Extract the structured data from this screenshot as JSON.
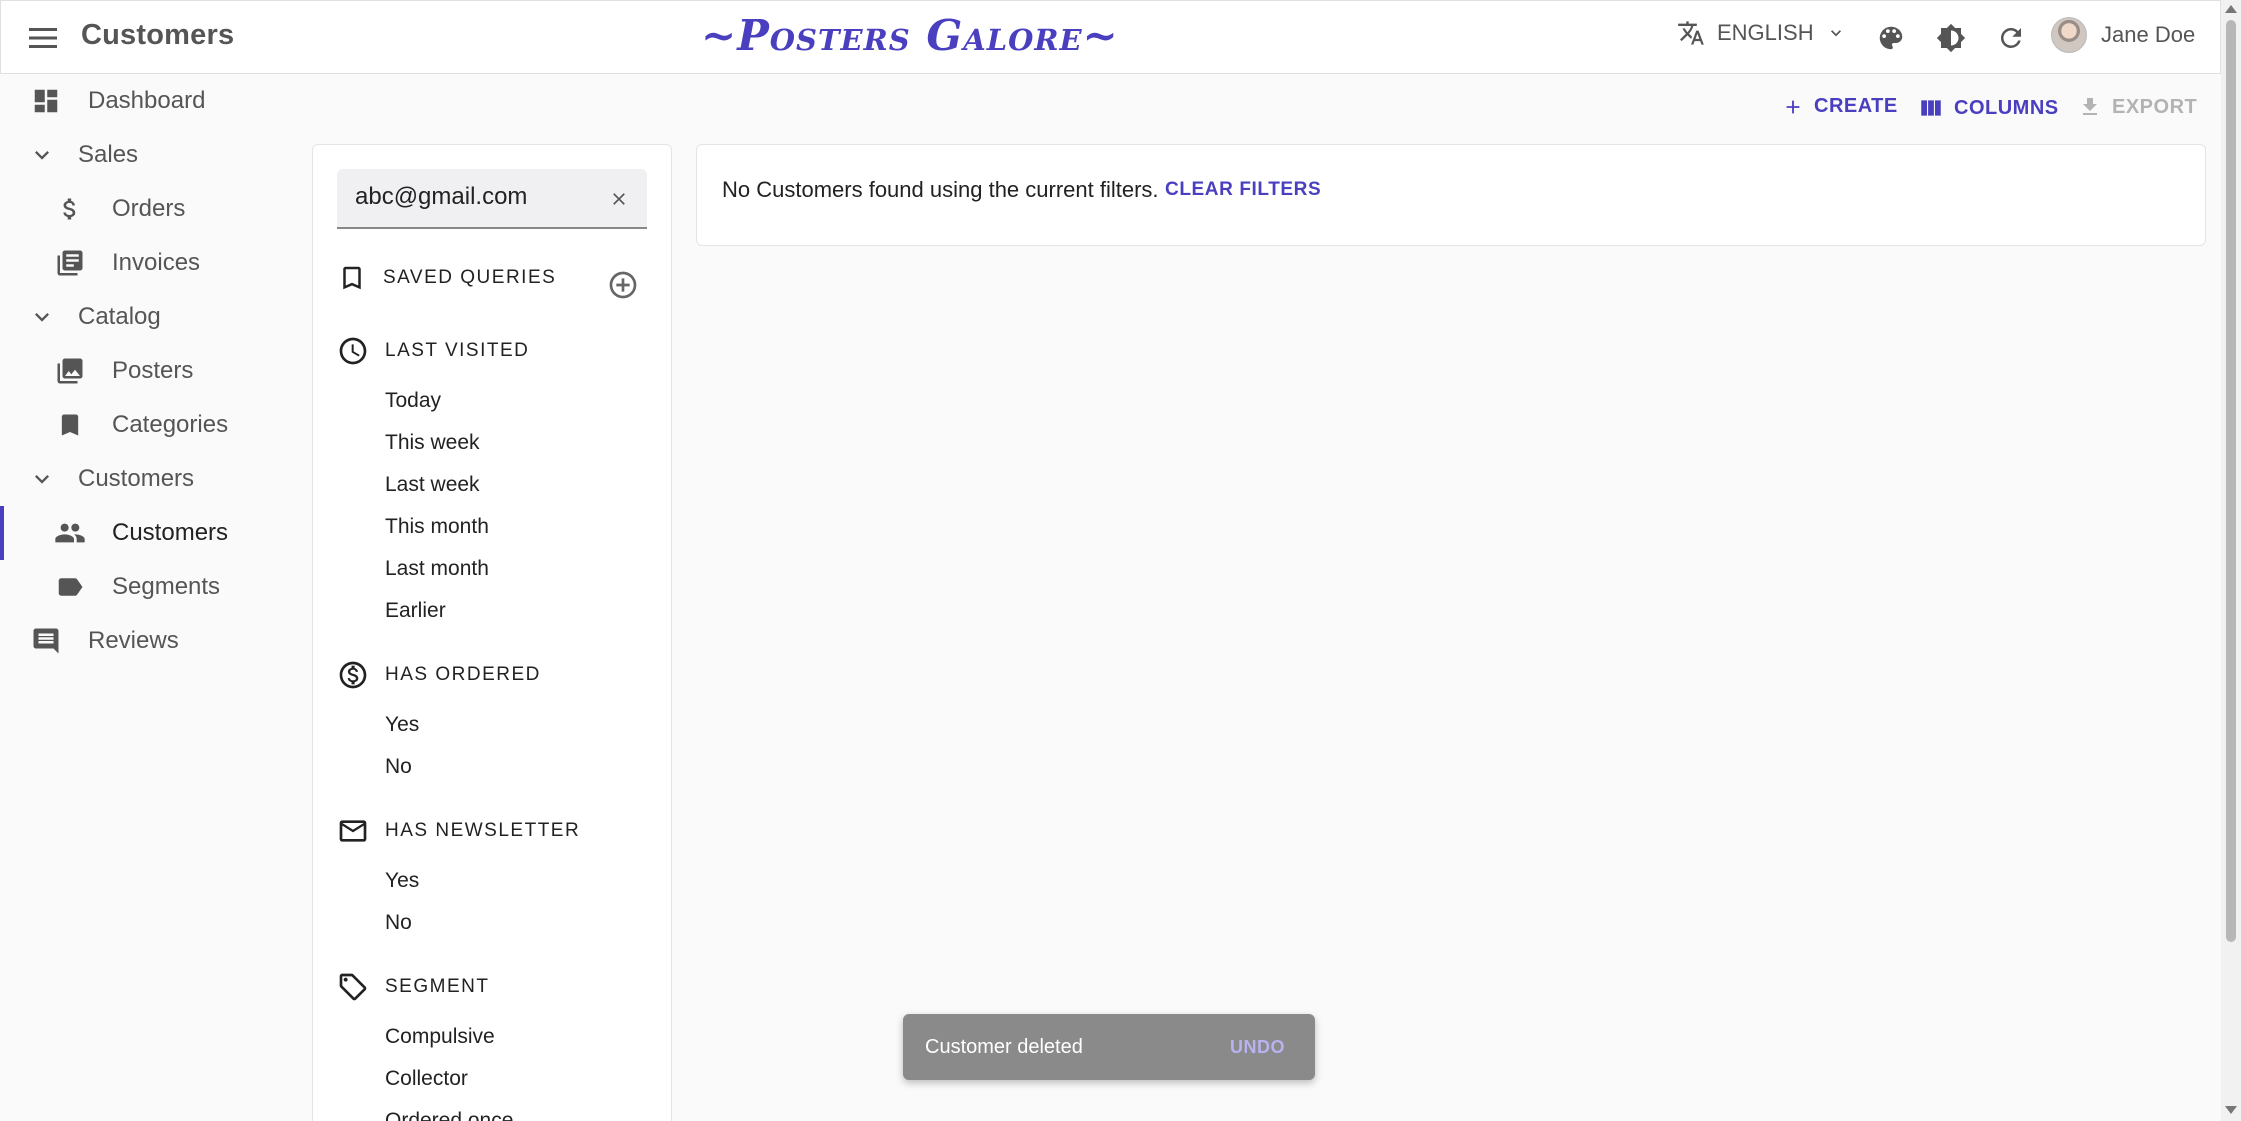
{
  "appbar": {
    "title": "Customers",
    "brand": "~Posters Galore~",
    "language": "ENGLISH",
    "user_name": "Jane Doe"
  },
  "sidebar": {
    "items": [
      {
        "label": "Dashboard",
        "icon": "dashboard-icon"
      },
      {
        "label": "Sales",
        "icon": "chevron-down-icon"
      },
      {
        "label": "Orders",
        "icon": "dollar-icon"
      },
      {
        "label": "Invoices",
        "icon": "invoice-icon"
      },
      {
        "label": "Catalog",
        "icon": "chevron-down-icon"
      },
      {
        "label": "Posters",
        "icon": "image-icon"
      },
      {
        "label": "Categories",
        "icon": "bookmark-icon"
      },
      {
        "label": "Customers",
        "icon": "chevron-down-icon"
      },
      {
        "label": "Customers",
        "icon": "people-icon",
        "active": true
      },
      {
        "label": "Segments",
        "icon": "label-icon"
      },
      {
        "label": "Reviews",
        "icon": "comment-icon"
      }
    ]
  },
  "toolbar": {
    "create_label": "CREATE",
    "columns_label": "COLUMNS",
    "export_label": "EXPORT"
  },
  "filters": {
    "search_value": "abc@gmail.com",
    "saved_queries_label": "SAVED QUERIES",
    "last_visited": {
      "label": "LAST VISITED",
      "options": [
        "Today",
        "This week",
        "Last week",
        "This month",
        "Last month",
        "Earlier"
      ]
    },
    "has_ordered": {
      "label": "HAS ORDERED",
      "options": [
        "Yes",
        "No"
      ]
    },
    "has_newsletter": {
      "label": "HAS NEWSLETTER",
      "options": [
        "Yes",
        "No"
      ]
    },
    "segment": {
      "label": "SEGMENT",
      "options": [
        "Compulsive",
        "Collector",
        "Ordered once"
      ]
    }
  },
  "main": {
    "empty_message": "No Customers found using the current filters.",
    "clear_filters_label": "CLEAR FILTERS"
  },
  "snackbar": {
    "message": "Customer deleted",
    "undo_label": "UNDO"
  },
  "colors": {
    "accent": "#4a3fbf",
    "snackbar_bg": "#8a8a8a"
  }
}
